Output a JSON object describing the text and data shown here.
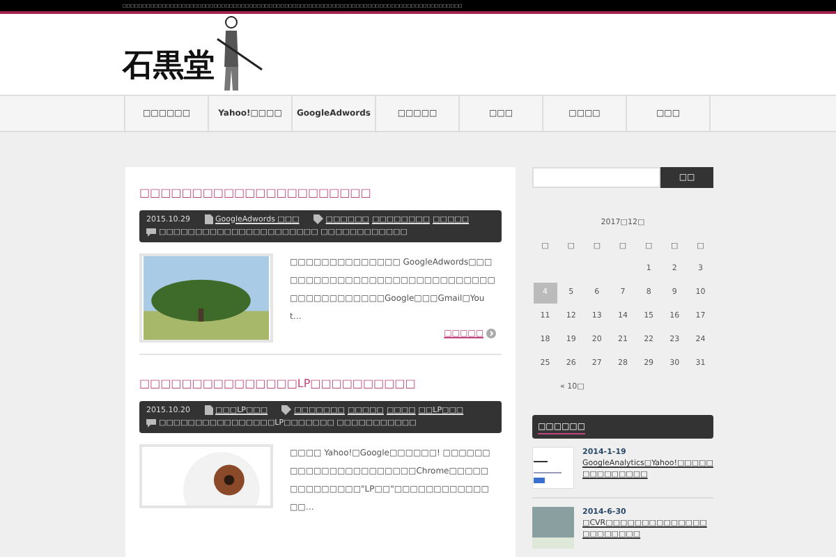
{
  "top_bar": {
    "text": "□□□□□□□□□□□□□□□□□□□□□□□□□□□□□□□□□□□□□□□□□□□□□□□□□□□□□□□□□□□□□□□□□□□□□□□□□□□□□□□□□□□□□□"
  },
  "logo": {
    "text": "石黒堂"
  },
  "nav": [
    {
      "label": "□□□□□□"
    },
    {
      "label": "Yahoo!□□□□"
    },
    {
      "label": "GoogleAdwords"
    },
    {
      "label": "□□□□□"
    },
    {
      "label": "□□□"
    },
    {
      "label": "□□□□"
    },
    {
      "label": "□□□"
    }
  ],
  "posts": [
    {
      "title": "□□□□□□□□□□□□□□□□□□□□□□",
      "date": "2015.10.29",
      "category": "GoogleAdwords □□□",
      "tags": [
        "□□□□□□",
        "□□□□□□□□",
        "□□□□□"
      ],
      "comments": "□□□□□□□□□□□□□□□□□□□□□□ □□□□□□□□□□□□",
      "excerpt": "□□□□□□□□□□□□□□ GoogleAdwords□□□□□□□□□□□□□□□□□□□□□□□□□□□□□□□□□□□□□□□□□Google□□□Gmail□Yout…",
      "more": "□□□□□"
    },
    {
      "title": "□□□□□□□□□□□□□□□LP□□□□□□□□□□",
      "date": "2015.10.20",
      "category": "□□□LP□□□",
      "tags": [
        "□□□□□□□",
        "□□□□□",
        "□□□□",
        "□□LP□□□"
      ],
      "comments": "□□□□□□□□□□□□□□□□LP□□□□□□□ □□□□□□□□□□□",
      "excerpt": "□□□□ Yahoo!□Google□□□□□□! □□□□□□□□□□□□□□□□□□□□□□Chrome□□□□□□□□□□□□□□\"LP□□\"□□□□□□□□□□□□□□…"
    }
  ],
  "sidebar": {
    "search_button": "□□",
    "calendar": {
      "caption": "2017□12□",
      "weekdays": [
        "□",
        "□",
        "□",
        "□",
        "□",
        "□",
        "□"
      ],
      "weeks": [
        [
          {
            "day": "1",
            "selected": false
          },
          {
            "day": "2",
            "selected": false
          },
          {
            "day": "3",
            "selected": false
          }
        ],
        [
          {
            "day": "4",
            "selected": true
          },
          {
            "day": "5",
            "selected": false
          },
          {
            "day": "6",
            "selected": false
          },
          {
            "day": "7",
            "selected": false
          },
          {
            "day": "8",
            "selected": false
          },
          {
            "day": "9",
            "selected": false
          },
          {
            "day": "10",
            "selected": false
          }
        ],
        [
          {
            "day": "11",
            "selected": false
          },
          {
            "day": "12",
            "selected": false
          },
          {
            "day": "13",
            "selected": false
          },
          {
            "day": "14",
            "selected": false
          },
          {
            "day": "15",
            "selected": false
          },
          {
            "day": "16",
            "selected": false
          },
          {
            "day": "17",
            "selected": false
          }
        ],
        [
          {
            "day": "18",
            "selected": false
          },
          {
            "day": "19",
            "selected": false
          },
          {
            "day": "20",
            "selected": false
          },
          {
            "day": "21",
            "selected": false
          },
          {
            "day": "22",
            "selected": false
          },
          {
            "day": "23",
            "selected": false
          },
          {
            "day": "24",
            "selected": false
          }
        ],
        [
          {
            "day": "25",
            "selected": false
          },
          {
            "day": "26",
            "selected": false
          },
          {
            "day": "27",
            "selected": false
          },
          {
            "day": "28",
            "selected": false
          },
          {
            "day": "29",
            "selected": false
          },
          {
            "day": "30",
            "selected": false
          },
          {
            "day": "31",
            "selected": false
          }
        ]
      ],
      "prev": "« 10□"
    },
    "popular": {
      "heading": "□□□□□□",
      "items": [
        {
          "date": "2014-1-19",
          "title": "GoogleAnalytics□Yahoo!□□□□□□□□□□□□□□"
        },
        {
          "date": "2014-6-30",
          "title": "□CVR□□□□□□□□□□□□□□□□□□□□□□"
        }
      ]
    }
  }
}
